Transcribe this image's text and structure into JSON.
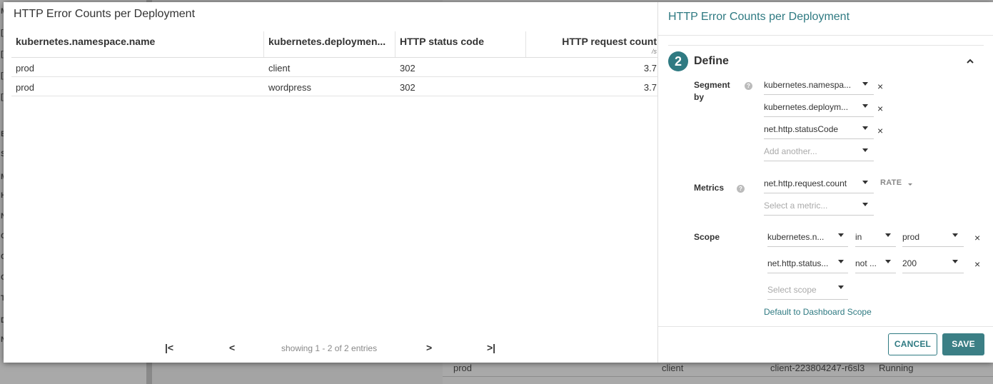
{
  "background": {
    "side_letters": [
      "M",
      "[",
      "[",
      "[",
      "[",
      "E",
      "S",
      "M",
      "H",
      "N",
      "C",
      "C",
      "C",
      "T",
      "D",
      "N"
    ],
    "row": {
      "namespace": "prod",
      "deployment": "client",
      "pod": "client-223804247-r6sl3",
      "status": "Running"
    }
  },
  "preview": {
    "title": "HTTP Error Counts per Deployment",
    "columns": [
      {
        "label": "kubernetes.namespace.name"
      },
      {
        "label": "kubernetes.deploymen..."
      },
      {
        "label": "HTTP status code"
      },
      {
        "label": "HTTP request count",
        "unit": "/s"
      }
    ],
    "rows": [
      {
        "namespace": "prod",
        "deployment": "client",
        "status_code": "302",
        "count": "3.7"
      },
      {
        "namespace": "prod",
        "deployment": "wordpress",
        "status_code": "302",
        "count": "3.7"
      }
    ],
    "pager": {
      "first": "|<",
      "prev": "<",
      "info": "showing 1 - 2 of 2 entries",
      "next": ">",
      "last": ">|"
    }
  },
  "panel": {
    "title": "HTTP Error Counts per Deployment",
    "step_number": "2",
    "section_title": "Define",
    "segment_label_1": "Segment",
    "segment_label_2": "by",
    "segments": [
      "kubernetes.namespa...",
      "kubernetes.deploym...",
      "net.http.statusCode"
    ],
    "segment_placeholder": "Add another...",
    "metrics_label": "Metrics",
    "metric": "net.http.request.count",
    "metric_aggregation": "RATE",
    "metric_placeholder": "Select a metric...",
    "scope_label": "Scope",
    "scope": [
      {
        "key": "kubernetes.n...",
        "op": "in",
        "value": "prod"
      },
      {
        "key": "net.http.status...",
        "op": "not ...",
        "value": "200"
      }
    ],
    "scope_placeholder": "Select scope",
    "default_scope_link": "Default to Dashboard Scope",
    "help": "?",
    "remove": "×",
    "cancel": "CANCEL",
    "save": "SAVE"
  },
  "colors": {
    "accent": "#2f7a82",
    "save": "#3b7f85"
  }
}
